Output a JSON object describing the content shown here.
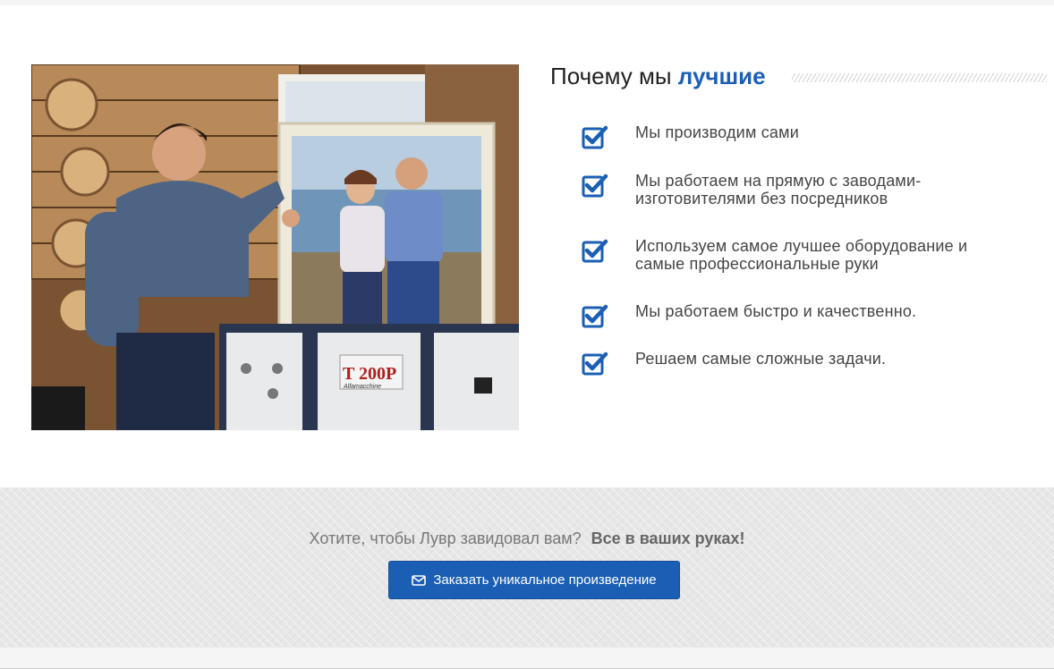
{
  "section": {
    "heading_prefix": "Почему мы",
    "heading_accent": "лучшие",
    "features": [
      "Мы производим сами",
      "Мы работаем на прямую с заводами-изготовителями без посредников",
      "Используем самое лучшее оборудование и самые профессиональные руки",
      "Мы работаем быстро и качественно.",
      "Решаем самые сложные задачи."
    ],
    "photo": {
      "machine_label": "T 200P",
      "machine_sublabel": "Alfamacchine"
    }
  },
  "cta": {
    "question": "Хотите, чтобы Лувр завидовал вам?",
    "emphasis": "Все в ваших руках!",
    "button_label": "Заказать уникальное произведение",
    "button_icon": "envelope-icon"
  },
  "colors": {
    "accent": "#1b5fb4",
    "check": "#1b5fb4",
    "cta_background": "#e7e7e7"
  }
}
